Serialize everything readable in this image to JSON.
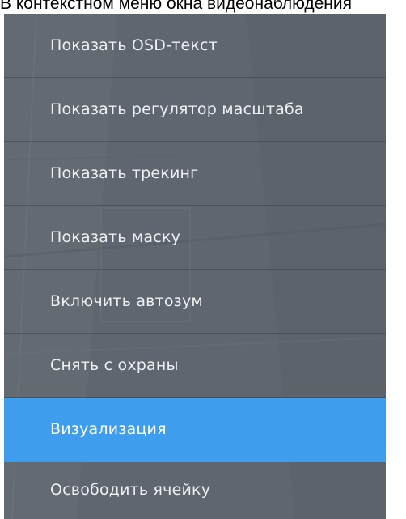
{
  "caption": {
    "text": "В контекстном меню окна видеонаблюдения"
  },
  "context_menu": {
    "colors": {
      "background": "#5f656e",
      "selected_background": "#3e9ded",
      "text": "#eef0f3"
    },
    "selected_label": "Визуализация",
    "items": [
      {
        "label": "Показать OSD-текст"
      },
      {
        "label": "Показать регулятор масштаба"
      },
      {
        "label": "Показать трекинг"
      },
      {
        "label": "Показать маску"
      },
      {
        "label": "Включить автозум"
      },
      {
        "label": "Снять с охраны"
      },
      {
        "label": "Визуализация"
      },
      {
        "label": "Освободить ячейку"
      }
    ]
  }
}
